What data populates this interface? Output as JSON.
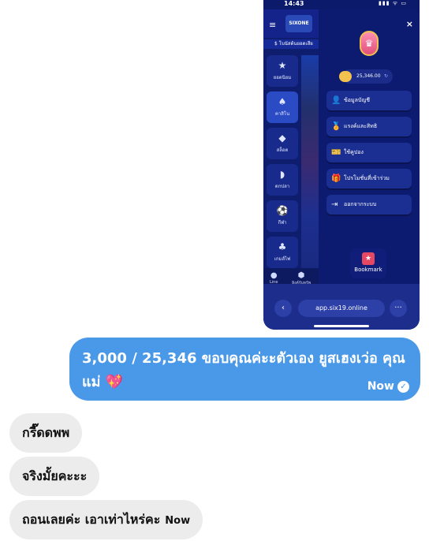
{
  "phone_screenshot": {
    "status_bar": {
      "time": "14:43",
      "icons": "▮▮▮ ᯤ ▭"
    },
    "site": {
      "logo_text": "SIXONE",
      "ticker": "$ โบนัสต้นยอดเสีย",
      "nav": [
        {
          "label": "ยอดนิยม",
          "icon": "★"
        },
        {
          "label": "คาสิโน",
          "icon": "♠"
        },
        {
          "label": "สล็อต",
          "icon": "◆"
        },
        {
          "label": "ตกปลา",
          "icon": "◗"
        },
        {
          "label": "กีฬา",
          "icon": "⚽"
        },
        {
          "label": "เกมส์ไพ่",
          "icon": "♣"
        }
      ],
      "bottom_nav": [
        {
          "label": "Line",
          "icon": "●"
        },
        {
          "label": "ลิงค์รับทรัพ",
          "icon": "⬢"
        }
      ]
    },
    "menu": {
      "close_icon": "×",
      "badge_icon": "♛",
      "balance": "25,346.00",
      "refresh_icon": "↻",
      "items": [
        {
          "label": "ข้อมูลบัญชี",
          "icon": "👤"
        },
        {
          "label": "แรงค์และสิทธิ",
          "icon": "🏅"
        },
        {
          "label": "ใช้คูปอง",
          "icon": "🎫"
        },
        {
          "label": "โปรโมชั่นที่เข้าร่วม",
          "icon": "🎁"
        },
        {
          "label": "ออกจากระบบ",
          "icon": "⇥"
        }
      ],
      "bookmark_label": "Bookmark",
      "bookmark_icon": "★"
    },
    "browser_bar": {
      "url": "app.six19.online",
      "back_icon": "‹",
      "more_icon": "···"
    }
  },
  "chat": {
    "outgoing": {
      "text": "3,000 / 25,346 ขอบคุณค่ะะตัวเอง ยูสเฮงเว่อ คุณแม่ 💖",
      "time": "Now",
      "check_icon": "✓"
    },
    "incoming": [
      {
        "text": "กรี๊ดดพพ",
        "time": ""
      },
      {
        "text": "จริงมั้ยคะะะ",
        "time": ""
      },
      {
        "text": "ถอนเลยค่ะ เอาเท่าไหร่คะ",
        "time": "Now"
      }
    ]
  }
}
